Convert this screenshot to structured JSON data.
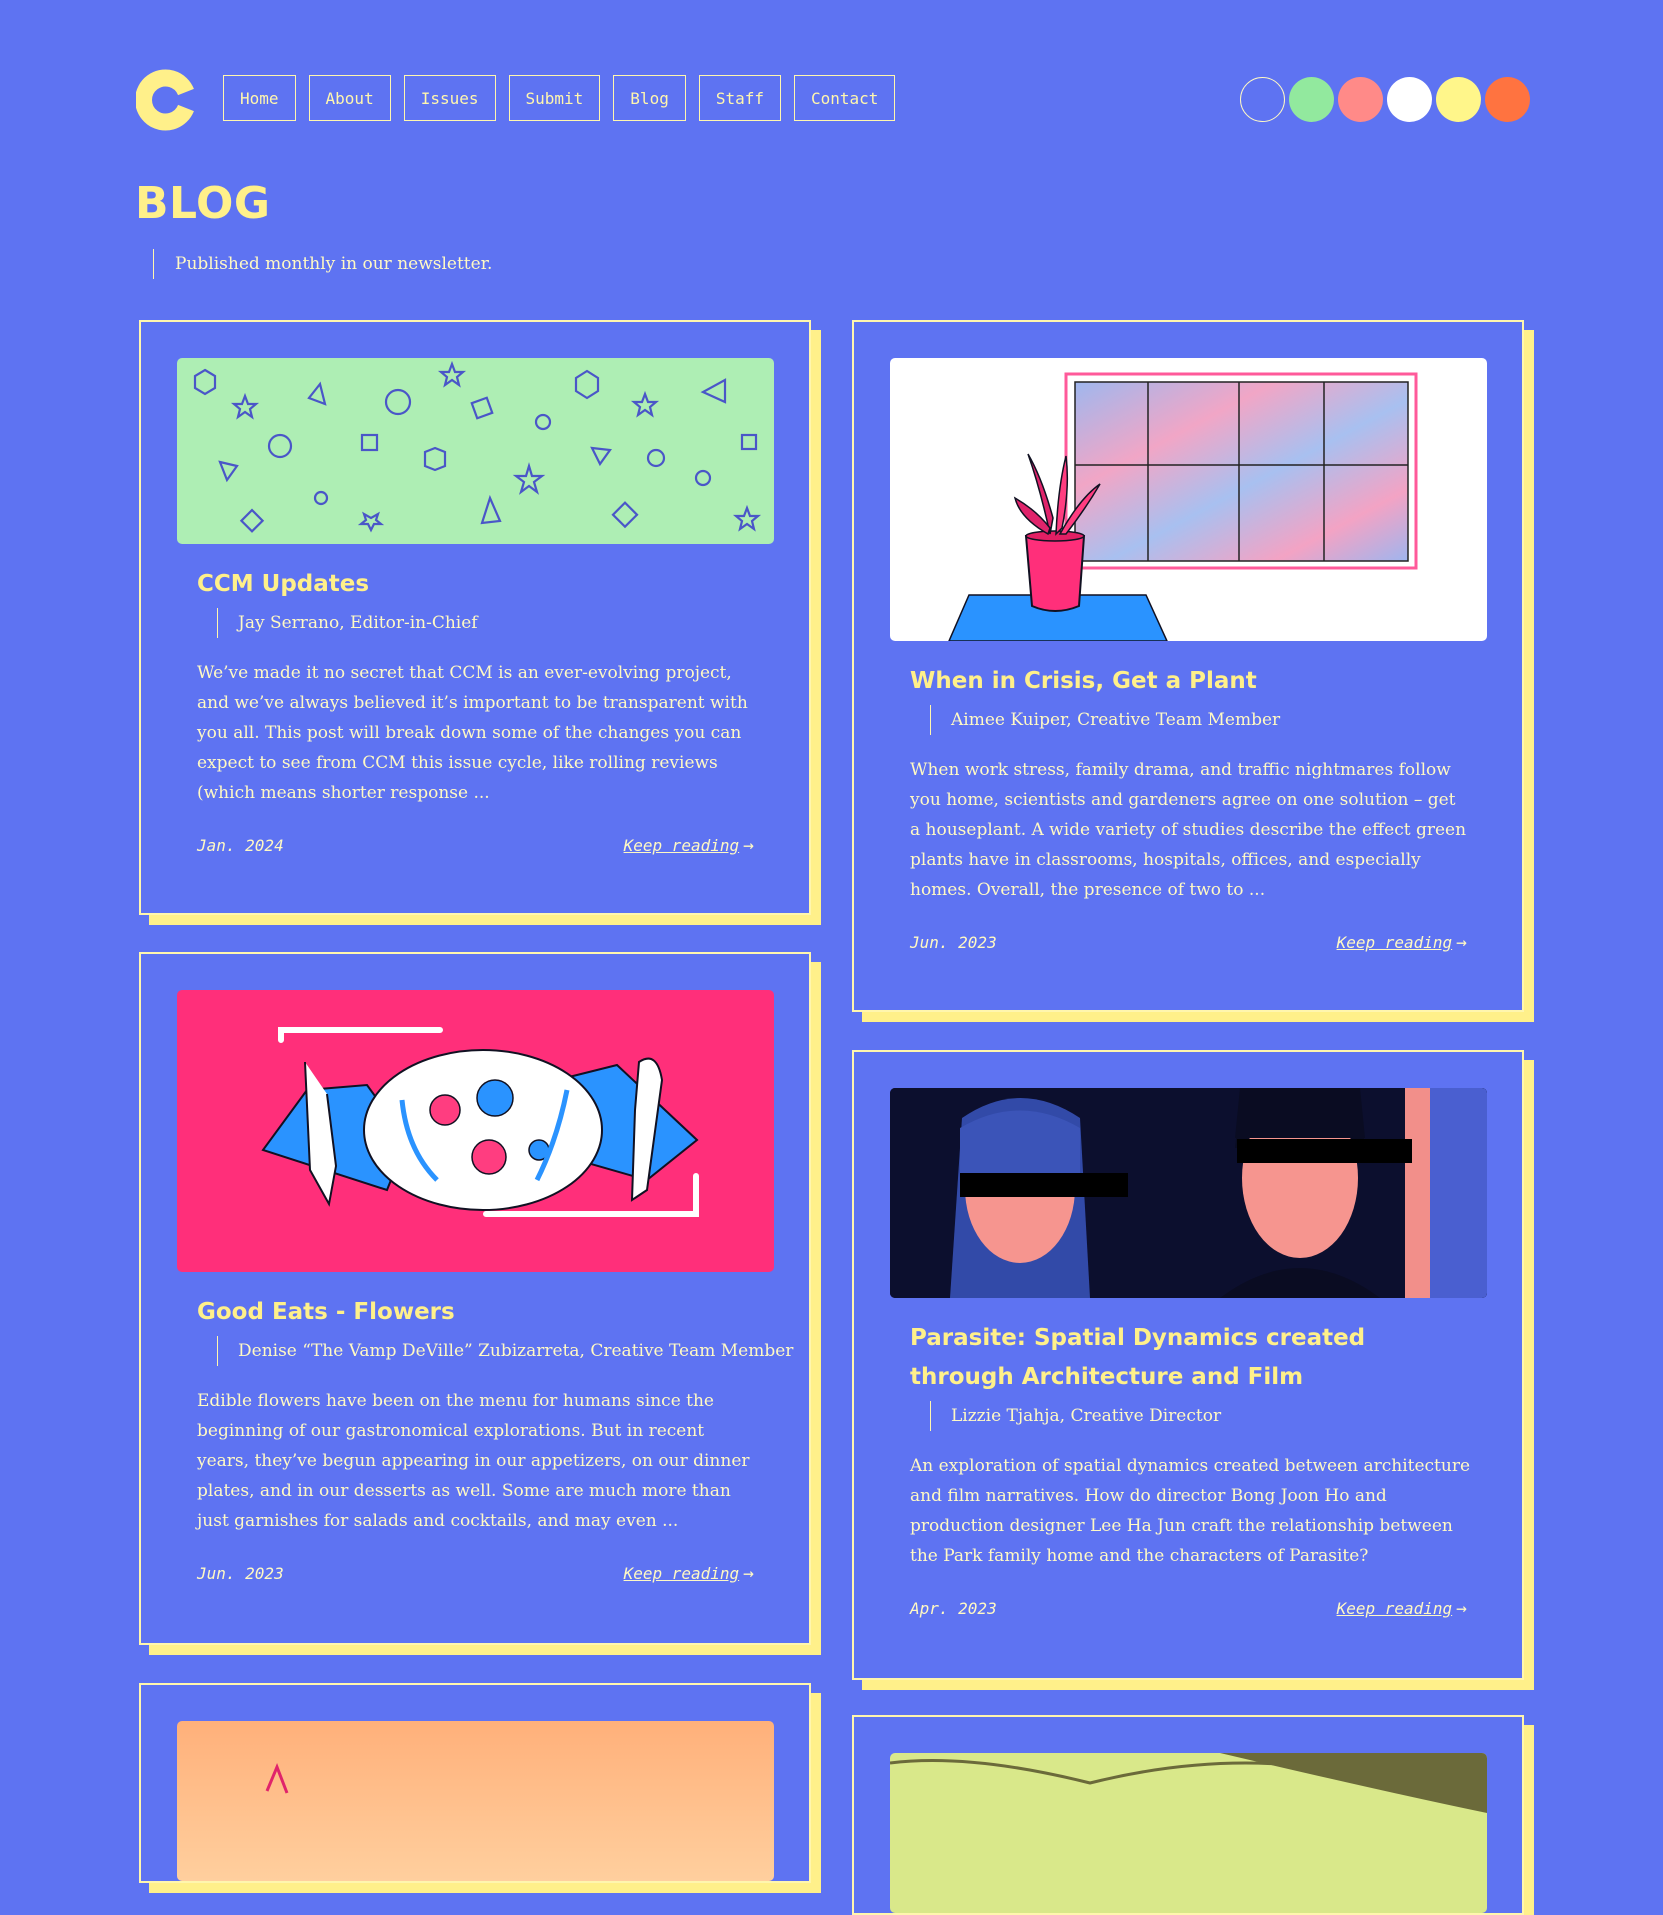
{
  "nav": {
    "items": [
      "Home",
      "About",
      "Issues",
      "Submit",
      "Blog",
      "Staff",
      "Contact"
    ]
  },
  "theme_swatches": [
    {
      "name": "blue",
      "color": "#5e73f2"
    },
    {
      "name": "green",
      "color": "#92e99e"
    },
    {
      "name": "pink",
      "color": "#ff8a88"
    },
    {
      "name": "white",
      "color": "#ffffff"
    },
    {
      "name": "yellow",
      "color": "#fff68a"
    },
    {
      "name": "orange",
      "color": "#ff7340"
    }
  ],
  "page": {
    "title": "BLOG",
    "subtitle": "Published monthly in our newsletter."
  },
  "colors": {
    "background": "#5e73f2",
    "accent": "#fff08a",
    "text": "#fff9c4"
  },
  "posts": [
    {
      "title": "CCM Updates",
      "author": "Jay Serrano, Editor-in-Chief",
      "excerpt": "We’ve made it no secret that CCM is an ever-evolving project, and we’ve always believed it’s important to be transparent with you all. This post will break down some of the changes you can expect to see from CCM this issue cycle, like rolling reviews (which means shorter response ...",
      "date": "Jan. 2024",
      "link": "Keep reading"
    },
    {
      "title": "When in Crisis, Get a Plant",
      "author": "Aimee Kuiper, Creative Team Member",
      "excerpt": "When work stress, family drama, and traffic nightmares follow you home, scientists and gardeners agree on one solution – get a houseplant. A wide variety of studies describe the effect green plants have in classrooms, hospitals, offices, and especially homes. Overall, the presence of two to ...",
      "date": "Jun. 2023",
      "link": "Keep reading"
    },
    {
      "title": "Good Eats - Flowers",
      "author": "Denise “The Vamp DeVille” Zubizarreta, Creative Team Member",
      "excerpt": "Edible flowers have been on the menu for humans since the beginning of our gastronomical explorations. But in recent years, they’ve begun appearing in our appetizers, on our dinner plates, and in our desserts as well. Some are much more than just garnishes for salads and cocktails, and may even ...",
      "date": "Jun. 2023",
      "link": "Keep reading"
    },
    {
      "title": "Parasite: Spatial Dynamics created through Architecture and Film",
      "author": "Lizzie Tjahja, Creative Director",
      "excerpt": "An exploration of spatial dynamics created between architecture and film narratives. How do director Bong Joon Ho and production designer Lee Ha Jun craft the relationship between the Park family home and the characters of Parasite?",
      "date": "Apr. 2023",
      "link": "Keep reading"
    }
  ]
}
